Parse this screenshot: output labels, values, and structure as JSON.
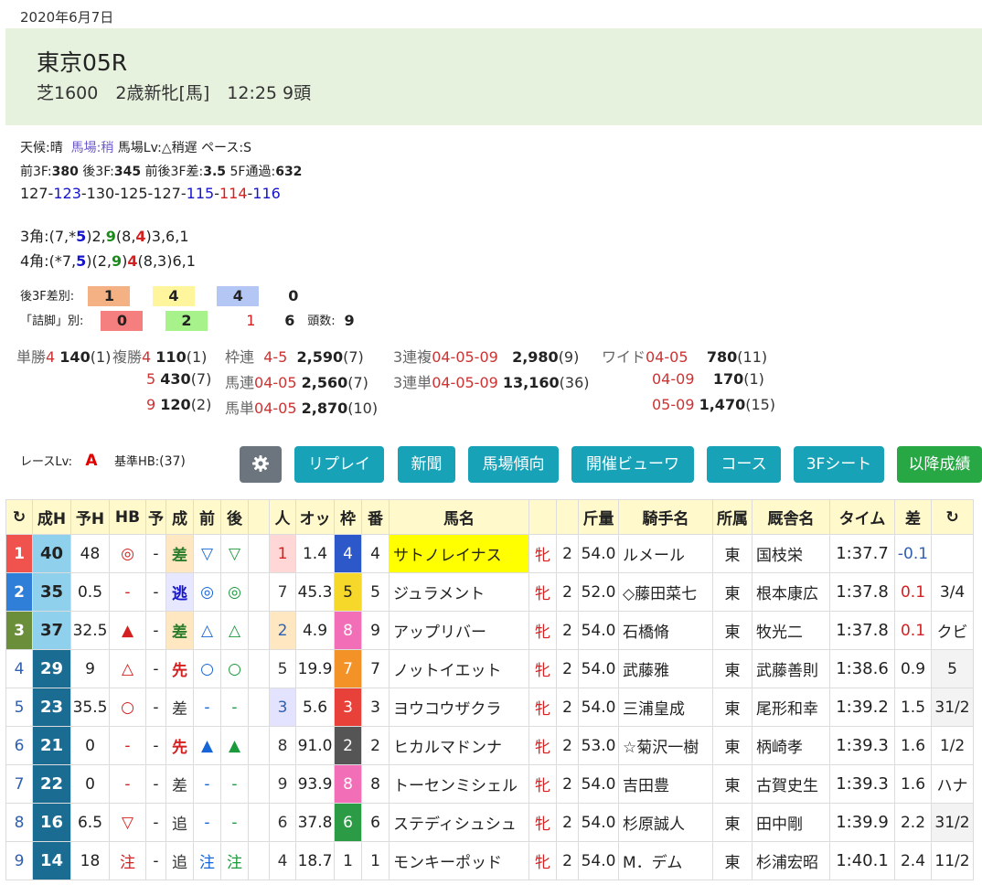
{
  "date": "2020年6月7日",
  "race": {
    "name": "東京05R",
    "sub": "芝1600　2歳新牝[馬]　12:25 9頭"
  },
  "info": {
    "weather_label": "天候:晴",
    "track_label": "馬場:稍",
    "track_lv": "馬場Lv:△稍遅",
    "pace": "ペース:S",
    "first3f_label": "前3F:",
    "first3f": "380",
    "last3f_label": "後3F:",
    "last3f": "345",
    "diff_label": "前後3F差:",
    "diff": "3.5",
    "pass5f_label": "5F通過:",
    "pass5f": "632",
    "laps": [
      "127",
      "123",
      "130",
      "125",
      "127",
      "115",
      "114",
      "116"
    ],
    "corner3_label": "3角:",
    "corner4_label": "4角:"
  },
  "colors": {
    "lap_fast": "#1515cc",
    "lap_fastest": "#d42020",
    "accent": "#17a2b8",
    "gear_btn": "#6c757d",
    "green_btn": "#28a745",
    "header_bg": "#e6f2dd"
  },
  "stats": {
    "row1_label": "後3F差別:",
    "row1": [
      "1",
      "4",
      "4",
      "0"
    ],
    "row2_label": "「詰脚」別:",
    "row2": [
      "0",
      "2",
      "1",
      "6"
    ],
    "heads_label": "頭数:",
    "heads": "9"
  },
  "payouts": {
    "tansho": {
      "label": "単勝",
      "combo": "4",
      "amount": "140",
      "pop": "(1)"
    },
    "fukusho_label": "複勝",
    "fukusho": [
      {
        "combo": "4",
        "amount": "110",
        "pop": "(1)"
      },
      {
        "combo": "5",
        "amount": "430",
        "pop": "(7)"
      },
      {
        "combo": "9",
        "amount": "120",
        "pop": "(2)"
      }
    ],
    "wakuren": {
      "label": "枠連",
      "combo": "4-5",
      "amount": "2,590",
      "pop": "(7)"
    },
    "umaren": {
      "label": "馬連",
      "combo": "04-05",
      "amount": "2,560",
      "pop": "(7)"
    },
    "umatan": {
      "label": "馬単",
      "combo": "04-05",
      "amount": "2,870",
      "pop": "(10)"
    },
    "sanrenpuku": {
      "label": "3連複",
      "combo": "04-05-09",
      "amount": "2,980",
      "pop": "(9)"
    },
    "sanrentan": {
      "label": "3連単",
      "combo": "04-05-09",
      "amount": "13,160",
      "pop": "(36)"
    },
    "wide_label": "ワイド",
    "wide": [
      {
        "combo": "04-05",
        "amount": "780",
        "pop": "(11)"
      },
      {
        "combo": "04-09",
        "amount": "170",
        "pop": "(1)"
      },
      {
        "combo": "05-09",
        "amount": "1,470",
        "pop": "(15)"
      }
    ]
  },
  "race_lv": {
    "label": "レースLv:",
    "value": "A",
    "base_label": "基準HB:",
    "base": "(37)"
  },
  "buttons": [
    "リプレイ",
    "新聞",
    "馬場傾向",
    "開催ビューワ",
    "コース",
    "3Fシート",
    "以降成績"
  ],
  "table": {
    "headers": [
      "↻",
      "成H",
      "予H",
      "HB",
      "予",
      "成",
      "前",
      "後",
      "",
      "人",
      "オッ",
      "枠",
      "番",
      "馬名",
      "",
      "",
      "斤量",
      "騎手名",
      "所属",
      "厩舎名",
      "タイム",
      "差",
      "↻"
    ],
    "rows": [
      [
        "1",
        "40",
        "48",
        "◎",
        "-",
        "差",
        "▽",
        "▽",
        "",
        "1",
        "1.4",
        "4",
        "4",
        "サトノレイナス",
        "牝",
        "2",
        "54.0",
        "ルメール",
        "東",
        "国枝栄",
        "1:37.7",
        "-0.1",
        ""
      ],
      [
        "2",
        "35",
        "0.5",
        "-",
        "-",
        "逃",
        "◎",
        "◎",
        "",
        "7",
        "45.3",
        "5",
        "5",
        "ジュラメント",
        "牝",
        "2",
        "52.0",
        "◇藤田菜七",
        "東",
        "根本康広",
        "1:37.8",
        "0.1",
        "3/4"
      ],
      [
        "3",
        "37",
        "32.5",
        "▲",
        "-",
        "差",
        "△",
        "△",
        "",
        "2",
        "4.9",
        "8",
        "9",
        "アップリバー",
        "牝",
        "2",
        "54.0",
        "石橋脩",
        "東",
        "牧光二",
        "1:37.8",
        "0.1",
        "クビ"
      ],
      [
        "4",
        "29",
        "9",
        "△",
        "-",
        "先",
        "○",
        "○",
        "",
        "5",
        "19.9",
        "7",
        "7",
        "ノットイエット",
        "牝",
        "2",
        "54.0",
        "武藤雅",
        "東",
        "武藤善則",
        "1:38.6",
        "0.9",
        "5"
      ],
      [
        "5",
        "23",
        "35.5",
        "○",
        "-",
        "差",
        "-",
        "-",
        "",
        "3",
        "5.6",
        "3",
        "3",
        "ヨウコウザクラ",
        "牝",
        "2",
        "54.0",
        "三浦皇成",
        "東",
        "尾形和幸",
        "1:39.2",
        "1.5",
        "31/2"
      ],
      [
        "6",
        "21",
        "0",
        "-",
        "-",
        "先",
        "▲",
        "▲",
        "",
        "8",
        "91.0",
        "2",
        "2",
        "ヒカルマドンナ",
        "牝",
        "2",
        "53.0",
        "☆菊沢一樹",
        "東",
        "柄崎孝",
        "1:39.3",
        "1.6",
        "1/2"
      ],
      [
        "7",
        "22",
        "0",
        "-",
        "-",
        "差",
        "-",
        "-",
        "",
        "9",
        "93.9",
        "8",
        "8",
        "トーセンミシェル",
        "牝",
        "2",
        "54.0",
        "吉田豊",
        "東",
        "古賀史生",
        "1:39.3",
        "1.6",
        "ハナ"
      ],
      [
        "8",
        "16",
        "6.5",
        "▽",
        "-",
        "追",
        "-",
        "-",
        "",
        "6",
        "37.8",
        "6",
        "6",
        "ステディシュシュ",
        "牝",
        "2",
        "54.0",
        "杉原誠人",
        "東",
        "田中剛",
        "1:39.9",
        "2.2",
        "31/2"
      ],
      [
        "9",
        "14",
        "18",
        "注",
        "-",
        "追",
        "注",
        "注",
        "",
        "4",
        "18.7",
        "1",
        "1",
        "モンキーポッド",
        "牝",
        "2",
        "54.0",
        "M．デム",
        "東",
        "杉浦宏昭",
        "1:40.1",
        "2.4",
        "11/2"
      ]
    ]
  }
}
